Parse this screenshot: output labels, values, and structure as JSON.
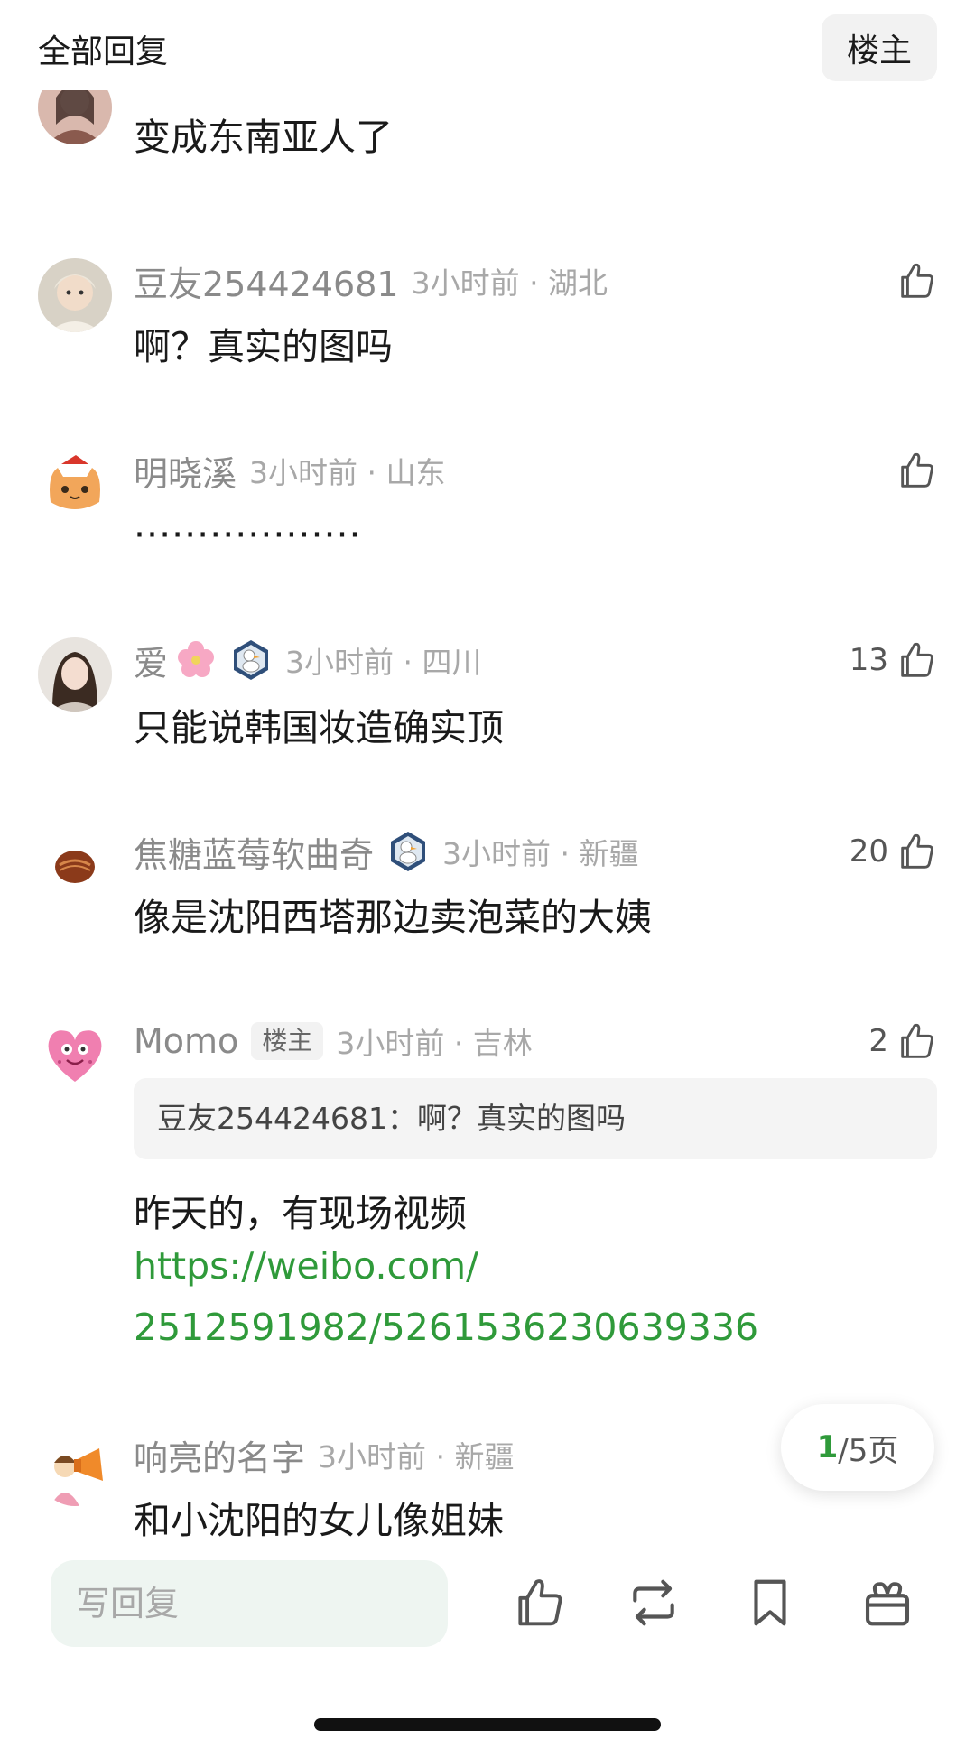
{
  "header": {
    "title": "全部回复",
    "op_button": "楼主"
  },
  "comments": [
    {
      "name": "",
      "time_loc": "",
      "text": "变成东南亚人了",
      "likes": ""
    },
    {
      "name": "豆友254424681",
      "time_loc": "3小时前 · 湖北",
      "text": "啊？真实的图吗",
      "likes": ""
    },
    {
      "name": "明晓溪",
      "time_loc": "3小时前 · 山东",
      "text": "··················",
      "likes": ""
    },
    {
      "name": "爱",
      "time_loc": "3小时前 · 四川",
      "text": "只能说韩国妆造确实顶",
      "likes": "13"
    },
    {
      "name": "焦糖蓝莓软曲奇",
      "time_loc": "3小时前 · 新疆",
      "text": "像是沈阳西塔那边卖泡菜的大姨",
      "likes": "20"
    },
    {
      "name": "Momo",
      "op_tag": "楼主",
      "time_loc": "3小时前 · 吉林",
      "quote": "豆友254424681：啊？真实的图吗",
      "text": "昨天的，有现场视频",
      "link_line1": "https://weibo.com/",
      "link_line2": "2512591982/5261536230639336",
      "likes": "2"
    },
    {
      "name": "响亮的名字",
      "time_loc": "3小时前 · 新疆",
      "text": "和小沈阳的女儿像姐妹",
      "likes": ""
    }
  ],
  "pager": {
    "current": "1",
    "total": "/5页"
  },
  "bottom_bar": {
    "reply_placeholder": "写回复"
  },
  "colors": {
    "accent_green": "#2f9a3a",
    "meta_gray": "#8a8a8a"
  }
}
